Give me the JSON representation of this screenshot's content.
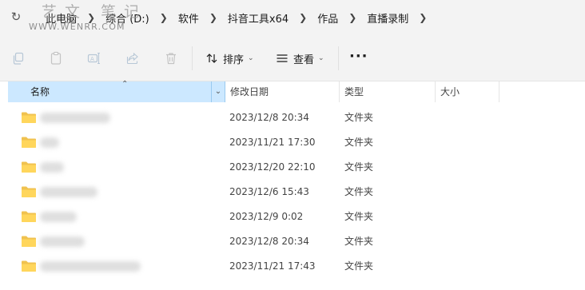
{
  "watermark": {
    "title": "艺文 笔记",
    "url": "WWW.WENRR.COM"
  },
  "breadcrumb": [
    "此电脑",
    "综合 (D:)",
    "软件",
    "抖音工具x64",
    "作品",
    "直播录制"
  ],
  "toolbar": {
    "icons": [
      "copy-icon",
      "paste-icon",
      "rename-icon",
      "share-icon",
      "delete-icon"
    ],
    "sort_label": "排序",
    "view_label": "查看",
    "more_label": "···"
  },
  "columns": {
    "name": "名称",
    "date": "修改日期",
    "type": "类型",
    "size": "大小"
  },
  "files": [
    {
      "date": "2023/12/8 20:34",
      "type": "文件夹"
    },
    {
      "date": "2023/11/21 17:30",
      "type": "文件夹"
    },
    {
      "date": "2023/12/20 22:10",
      "type": "文件夹"
    },
    {
      "date": "2023/12/6 15:43",
      "type": "文件夹"
    },
    {
      "date": "2023/12/9 0:02",
      "type": "文件夹"
    },
    {
      "date": "2023/12/8 20:34",
      "type": "文件夹"
    },
    {
      "date": "2023/11/21 17:43",
      "type": "文件夹"
    }
  ]
}
